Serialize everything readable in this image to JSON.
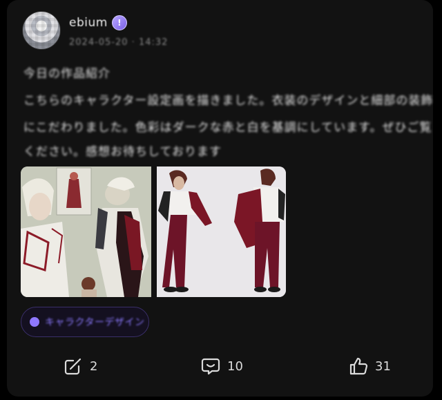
{
  "post": {
    "author": {
      "name": "ebium",
      "badge_icon": "exclamation-badge-icon",
      "meta": "2024-05-20  ·  14:32",
      "avatar_icon": "user-avatar"
    },
    "text_lines": [
      "今日の作品紹介",
      "こちらのキャラクター設定画を描きました。衣装のデザインと細部の装飾",
      "にこだわりました。色彩はダークな赤と白を基調にしています。ぜひご覧",
      "ください。感想お待ちしております"
    ],
    "images": [
      {
        "name": "character-sketch-collage"
      },
      {
        "name": "character-front-back-design"
      }
    ],
    "topic": {
      "label": "キャラクターデザイン"
    },
    "actions": {
      "share_count": "2",
      "comment_count": "10",
      "like_count": "31"
    },
    "colors": {
      "background": "#000000",
      "card": "#121212",
      "accent": "#8c7aff"
    }
  }
}
